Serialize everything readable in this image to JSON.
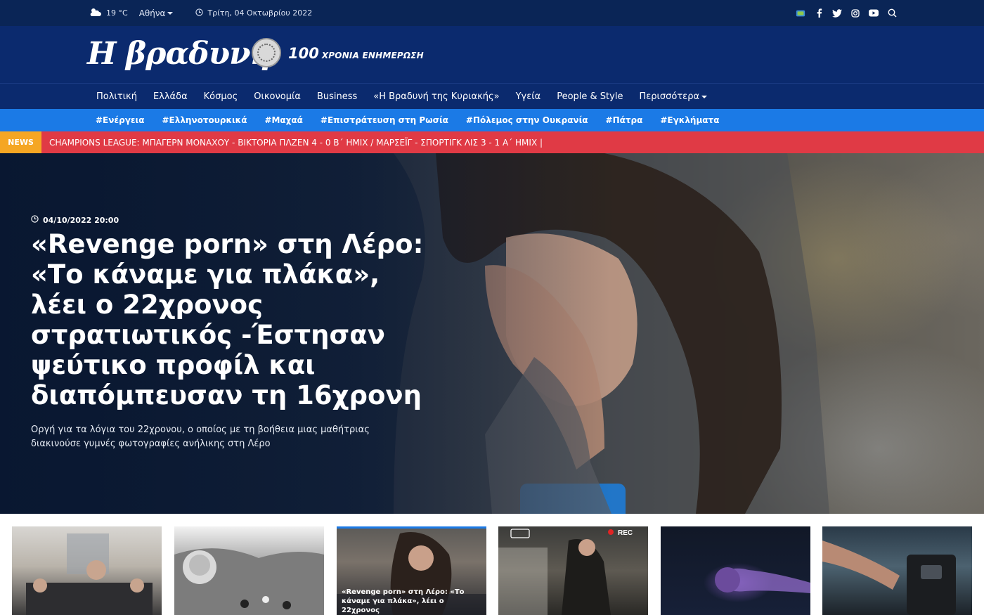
{
  "topbar": {
    "temperature": "19 °C",
    "city": "Αθήνα",
    "date": "Τρίτη, 04 Οκτωβρίου 2022",
    "icons": [
      "weather-cloud-icon",
      "caret-down-icon",
      "clock-icon",
      "gb-flag-icon",
      "facebook-icon",
      "twitter-icon",
      "instagram-icon",
      "youtube-icon",
      "search-icon"
    ]
  },
  "header": {
    "logo_text": "Η βραδυνή",
    "tagline_number": "100",
    "tagline_text": "ΧΡΟΝΙΑ ΕΝΗΜΕΡΩΣΗ",
    "colors": {
      "topbar": "#0a2556",
      "header": "#0b2a6e",
      "tags": "#1b7ae6",
      "ticker": "#e03a45",
      "news_label": "#f5a623"
    }
  },
  "nav": {
    "items": [
      "Πολιτική",
      "Ελλάδα",
      "Κόσμος",
      "Οικονομία",
      "Business",
      "«Η Βραδυνή της Κυριακής»",
      "Υγεία",
      "People & Style",
      "Περισσότερα"
    ]
  },
  "tags": {
    "items": [
      "#Ενέργεια",
      "#Ελληνοτουρκικά",
      "#Μαχαά",
      "#Επιστράτευση στη Ρωσία",
      "#Πόλεμος στην Ουκρανία",
      "#Πάτρα",
      "#Εγκλήματα"
    ]
  },
  "ticker": {
    "label": "NEWS",
    "text": "CHAMPIONS LEAGUE: ΜΠΑΓΕΡΝ ΜΟΝΑΧΟΥ - ΒΙΚΤΟΡΙΑ ΠΛΖΕΝ 4 - 0 Β΄ ΗΜΙΧ / ΜΑΡΣΕΪΓ - ΣΠΟΡΤΙΓΚ ΛΙΣ 3 - 1 Α΄ ΗΜΙΧ   |"
  },
  "hero": {
    "datetime": "04/10/2022 20:00",
    "title": "«Revenge porn» στη Λέρο: «Το κάναμε για πλάκα», λέει ο 22χρονος στρατιωτικός -Έστησαν ψεύτικο προφίλ και διαπόμπευσαν τη 16χρονη",
    "subtitle": "Οργή για τα λόγια του 22χρονου, ο οποίος με τη βοήθεια μιας μαθήτριας διακινούσε γυμνές φωτογραφίες ανήλικης στη Λέρο"
  },
  "cards": [
    {
      "caption": ""
    },
    {
      "caption": ""
    },
    {
      "caption": "«Revenge porn» στη Λέρο: «Το κάναμε για πλάκα», λέει ο 22χρονος"
    },
    {
      "caption": ""
    },
    {
      "caption": ""
    },
    {
      "caption": ""
    }
  ]
}
